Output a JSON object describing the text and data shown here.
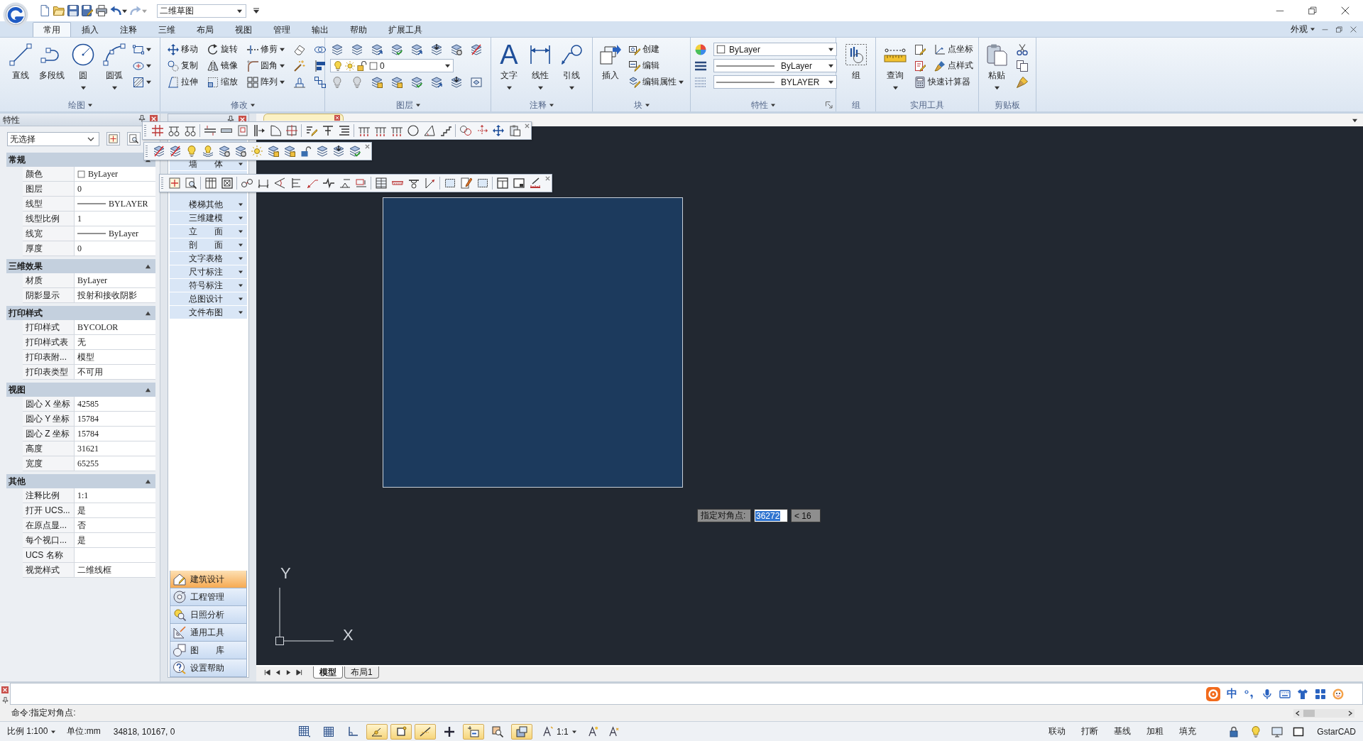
{
  "quick_access": {
    "buttons": [
      {
        "disabled": false
      },
      {
        "disabled": false
      },
      {
        "disabled": false
      },
      {
        "disabled": false
      },
      {
        "disabled": false
      },
      {
        "disabled": false,
        "menu": true
      },
      {
        "disabled": true,
        "menu": true
      }
    ],
    "workspace": "二维草图"
  },
  "ribbon": {
    "tabs": [
      {
        "label": "常用",
        "selected": true
      },
      {
        "label": "插入",
        "selected": false
      },
      {
        "label": "注释",
        "selected": false
      },
      {
        "label": "三维",
        "selected": false
      },
      {
        "label": "布局",
        "selected": false
      },
      {
        "label": "视图",
        "selected": false
      },
      {
        "label": "管理",
        "selected": false
      },
      {
        "label": "输出",
        "selected": false
      },
      {
        "label": "帮助",
        "selected": false
      },
      {
        "label": "扩展工具",
        "selected": false
      }
    ],
    "appearance_menu": "外观",
    "panels": [
      {
        "title": "绘图",
        "title_menu": true,
        "columns": [
          {
            "kind": "large",
            "label": "直线"
          },
          {
            "kind": "large",
            "label": "多段线"
          },
          {
            "kind": "large",
            "label": "圆",
            "menu": true
          },
          {
            "kind": "large",
            "label": "圆弧",
            "menu": true
          },
          {
            "kind": "stack",
            "rows": [
              [
                {
                  "kind": "icon_button",
                  "menu": true
                }
              ],
              [
                {
                  "kind": "icon_button",
                  "menu": true
                }
              ],
              [
                {
                  "kind": "icon_button",
                  "menu": true
                }
              ]
            ]
          }
        ]
      },
      {
        "title": "修改",
        "title_menu": true,
        "columns": [
          {
            "kind": "stack",
            "rows": [
              [
                {
                  "kind": "button",
                  "label": "移动"
                }
              ],
              [
                {
                  "kind": "button",
                  "label": "复制"
                }
              ],
              [
                {
                  "kind": "button",
                  "label": "拉伸"
                }
              ]
            ]
          },
          {
            "kind": "stack",
            "rows": [
              [
                {
                  "kind": "button",
                  "label": "旋转"
                }
              ],
              [
                {
                  "kind": "button",
                  "label": "镜像"
                }
              ],
              [
                {
                  "kind": "button",
                  "label": "缩放"
                }
              ]
            ]
          },
          {
            "kind": "stack",
            "rows": [
              [
                {
                  "kind": "button",
                  "label": "修剪",
                  "menu": true
                }
              ],
              [
                {
                  "kind": "button",
                  "label": "圆角",
                  "menu": true
                }
              ],
              [
                {
                  "kind": "button",
                  "label": "阵列",
                  "menu": true
                }
              ]
            ]
          },
          {
            "kind": "stack",
            "rows": [
              [
                {
                  "kind": "icon_button"
                }
              ],
              [
                {
                  "kind": "icon_button"
                }
              ],
              [
                {
                  "kind": "icon_button"
                }
              ]
            ]
          },
          {
            "kind": "stack",
            "rows": [
              [
                {
                  "kind": "icon_button"
                }
              ],
              [
                {
                  "kind": "icon_button"
                }
              ],
              [
                {
                  "kind": "icon_button"
                }
              ]
            ]
          }
        ]
      },
      {
        "title": "图层",
        "title_menu": true,
        "columns": [
          {
            "kind": "stack",
            "rows": [
              [
                {
                  "kind": "icon_button"
                },
                {
                  "kind": "icon_button"
                },
                {
                  "kind": "icon_button"
                },
                {
                  "kind": "icon_button"
                },
                {
                  "kind": "icon_button"
                },
                {
                  "kind": "icon_button"
                },
                {
                  "kind": "icon_button"
                },
                {
                  "kind": "icon_button"
                }
              ],
              [
                {
                  "kind": "layer_combo",
                  "value": "0"
                }
              ],
              [
                {
                  "kind": "icon_button"
                },
                {
                  "kind": "icon_button"
                },
                {
                  "kind": "icon_button"
                },
                {
                  "kind": "icon_button"
                },
                {
                  "kind": "icon_button"
                },
                {
                  "kind": "icon_button"
                },
                {
                  "kind": "icon_button"
                },
                {
                  "kind": "icon_button"
                }
              ]
            ]
          }
        ]
      },
      {
        "title": "注释",
        "title_menu": true,
        "columns": [
          {
            "kind": "large",
            "label": "文字",
            "glyph": "A",
            "menu": true
          },
          {
            "kind": "large",
            "label": "线性",
            "menu": true
          },
          {
            "kind": "large",
            "label": "引线",
            "menu": true
          }
        ]
      },
      {
        "title": "块",
        "title_menu": true,
        "columns": [
          {
            "kind": "large",
            "label": "插入"
          },
          {
            "kind": "stack",
            "rows": [
              [
                {
                  "kind": "button",
                  "label": "创建"
                }
              ],
              [
                {
                  "kind": "button",
                  "label": "编辑"
                }
              ],
              [
                {
                  "kind": "button",
                  "label": "编辑属性",
                  "menu": true
                }
              ]
            ]
          }
        ]
      },
      {
        "title": "特性",
        "title_menu": true,
        "launcher": true,
        "columns": [
          {
            "kind": "stack",
            "rows": [
              [
                {
                  "kind": "icon_button"
                },
                {
                  "kind": "swatch_combo",
                  "value": "ByLayer"
                }
              ],
              [
                {
                  "kind": "icon_button"
                },
                {
                  "kind": "line_combo",
                  "value": "ByLayer"
                }
              ],
              [
                {
                  "kind": "icon_button"
                },
                {
                  "kind": "line_combo",
                  "value": "BYLAYER"
                }
              ]
            ]
          }
        ]
      },
      {
        "title": "组",
        "columns": [
          {
            "kind": "large",
            "label": "组"
          }
        ]
      },
      {
        "title": "实用工具",
        "columns": [
          {
            "kind": "large",
            "label": "查询",
            "menu": true
          },
          {
            "kind": "stack",
            "rows": [
              [
                {
                  "kind": "icon_button"
                },
                {
                  "kind": "button",
                  "label": "点坐标"
                }
              ],
              [
                {
                  "kind": "icon_button"
                },
                {
                  "kind": "button",
                  "label": "点样式"
                }
              ],
              [
                {
                  "kind": "button",
                  "label": "快速计算器"
                }
              ]
            ]
          }
        ]
      },
      {
        "title": "剪贴板",
        "columns": [
          {
            "kind": "large",
            "label": "粘贴",
            "menu": true
          },
          {
            "kind": "stack",
            "rows": [
              [
                {
                  "kind": "icon_button"
                }
              ],
              [
                {
                  "kind": "icon_button"
                }
              ],
              [
                {
                  "kind": "icon_button"
                }
              ]
            ]
          }
        ]
      }
    ]
  },
  "properties_panel": {
    "title": "特性",
    "selection": "无选择",
    "sections": [
      {
        "title": "常规",
        "expanded": true,
        "rows": [
          {
            "label": "颜色",
            "value": "ByLayer",
            "kind": "color"
          },
          {
            "label": "图层",
            "value": "0",
            "kind": "text"
          },
          {
            "label": "线型",
            "value": "BYLAYER",
            "kind": "line"
          },
          {
            "label": "线型比例",
            "value": "1",
            "kind": "text"
          },
          {
            "label": "线宽",
            "value": "ByLayer",
            "kind": "line"
          },
          {
            "label": "厚度",
            "value": "0",
            "kind": "text"
          }
        ]
      },
      {
        "title": "三维效果",
        "expanded": true,
        "rows": [
          {
            "label": "材质",
            "value": "ByLayer",
            "kind": "text"
          },
          {
            "label": "阴影显示",
            "value": "投射和接收阴影",
            "kind": "text"
          }
        ]
      },
      {
        "title": "打印样式",
        "expanded": true,
        "rows": [
          {
            "label": "打印样式",
            "value": "BYCOLOR",
            "kind": "text"
          },
          {
            "label": "打印样式表",
            "value": "无",
            "kind": "text"
          },
          {
            "label": "打印表附...",
            "value": "模型",
            "kind": "text"
          },
          {
            "label": "打印表类型",
            "value": "不可用",
            "kind": "text"
          }
        ]
      },
      {
        "title": "视图",
        "expanded": true,
        "rows": [
          {
            "label": "圆心 X 坐标",
            "value": "42585",
            "kind": "text"
          },
          {
            "label": "圆心 Y 坐标",
            "value": "15784",
            "kind": "text"
          },
          {
            "label": "圆心 Z 坐标",
            "value": "15784",
            "kind": "text"
          },
          {
            "label": "高度",
            "value": "31621",
            "kind": "text"
          },
          {
            "label": "宽度",
            "value": "65255",
            "kind": "text"
          }
        ]
      },
      {
        "title": "其他",
        "expanded": true,
        "rows": [
          {
            "label": "注释比例",
            "value": "1:1",
            "kind": "text"
          },
          {
            "label": "打开 UCS...",
            "value": "是",
            "kind": "text"
          },
          {
            "label": "在原点显...",
            "value": "否",
            "kind": "text"
          },
          {
            "label": "每个视口...",
            "value": "是",
            "kind": "text"
          },
          {
            "label": "UCS 名称",
            "kind": "text"
          },
          {
            "label": "视觉样式",
            "value": "二维线框",
            "kind": "text"
          }
        ]
      }
    ]
  },
  "tool_palette": {
    "items": [
      "墙　　体",
      "楼梯其他",
      "三维建模",
      "立　　面",
      "剖　　面",
      "文字表格",
      "尺寸标注",
      "符号标注",
      "总图设计",
      "文件布图"
    ],
    "categories": [
      {
        "label": "建筑设计",
        "selected": true
      },
      {
        "label": "工程管理",
        "selected": false
      },
      {
        "label": "日照分析",
        "selected": false
      },
      {
        "label": "通用工具",
        "selected": false
      },
      {
        "label": "图　　库",
        "selected": false
      },
      {
        "label": "设置帮助",
        "selected": false
      }
    ]
  },
  "drawing": {
    "dynamic_input": {
      "prompt": "指定对角点:",
      "value": "36272",
      "angle": "< 16"
    },
    "ucs": {
      "x_label": "X",
      "y_label": "Y"
    },
    "layout_tabs": [
      {
        "label": "模型",
        "selected": true
      },
      {
        "label": "布局1",
        "selected": false
      }
    ]
  },
  "command_line": {
    "ime_mode": "中",
    "prompt": "命令:指定对角点:"
  },
  "status_bar": {
    "scale": "比例 1:100",
    "units": "单位:mm",
    "coordinates": "34818, 10167, 0",
    "toggles": [
      {
        "on": false
      },
      {
        "on": false
      },
      {
        "on": false
      },
      {
        "on": true
      },
      {
        "on": true
      },
      {
        "on": true
      },
      {
        "on": false
      },
      {
        "on": true
      },
      {
        "on": false
      },
      {
        "on": true
      }
    ],
    "annotation_scale": "1:1",
    "modes": [
      "联动",
      "打断",
      "基线",
      "加粗",
      "填充"
    ],
    "product": "GstarCAD"
  }
}
